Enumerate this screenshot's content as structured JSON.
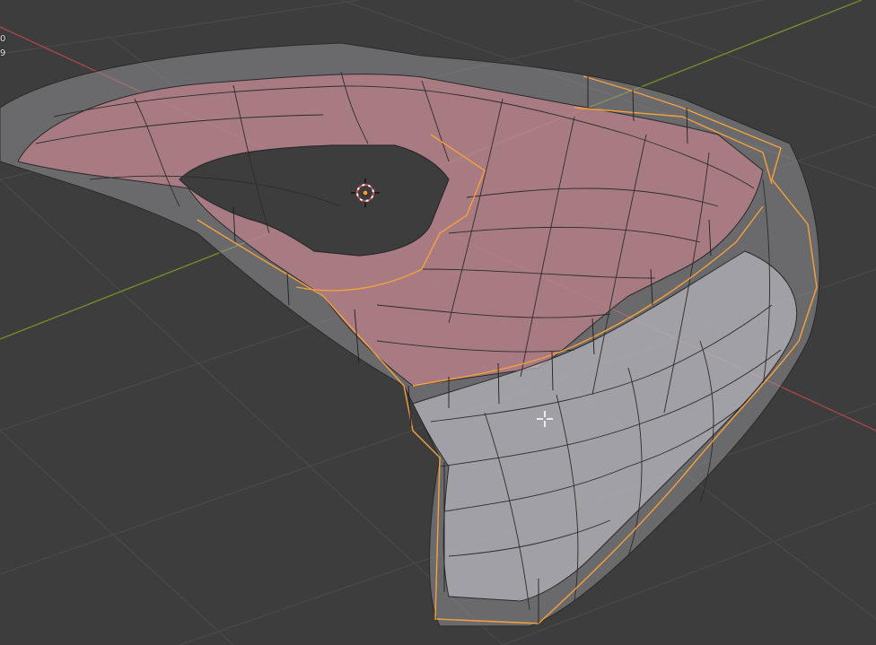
{
  "viewport": {
    "background": "#3d3d3d",
    "grid_color": "#484848",
    "x_axis_color": "#b0484f",
    "y_axis_color": "#7a9a2a",
    "selection_outline_color": "#f5a03c",
    "wire_color": "#2a2a2a",
    "mesh_face_color": "#9a9aa2",
    "mesh_shade_color": "#c08088",
    "icons": {
      "origin": "3d-cursor-icon",
      "mouse": "crosshair-cursor-icon"
    }
  },
  "stats_overlay": {
    "line1": "0",
    "line2": "9"
  }
}
